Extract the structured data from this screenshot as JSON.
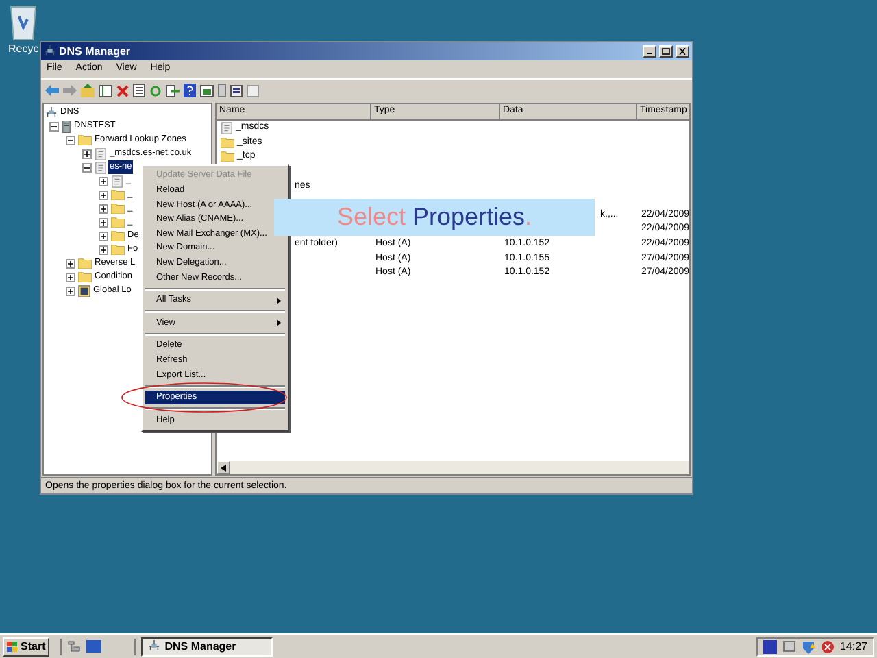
{
  "desktop_icons": [
    {
      "label": "Recyc"
    }
  ],
  "window": {
    "title": "DNS Manager",
    "menu": [
      "File",
      "Action",
      "View",
      "Help"
    ],
    "tree": [
      {
        "label": "DNS",
        "kind": "dns",
        "children": [
          {
            "label": "DNSTEST",
            "kind": "server",
            "expanded": true,
            "children": [
              {
                "label": "Forward Lookup Zones",
                "kind": "folder",
                "expanded": true,
                "children": [
                  {
                    "label": "_msdcs.es-net.co.uk",
                    "kind": "zone",
                    "expanded": false,
                    "selected": false
                  },
                  {
                    "label": "es-ne",
                    "kind": "zone",
                    "expanded": true,
                    "selected": true,
                    "children": [
                      {
                        "label": "_",
                        "kind": "zone",
                        "expanded": false
                      },
                      {
                        "label": "_",
                        "kind": "folder",
                        "expanded": false
                      },
                      {
                        "label": "_",
                        "kind": "folder",
                        "expanded": false
                      },
                      {
                        "label": "_",
                        "kind": "folder",
                        "expanded": false
                      },
                      {
                        "label": "De",
                        "kind": "folder",
                        "expanded": false
                      },
                      {
                        "label": "Fo",
                        "kind": "folder",
                        "expanded": false
                      }
                    ]
                  }
                ]
              },
              {
                "label": "Reverse L",
                "kind": "folder",
                "expanded": false
              },
              {
                "label": "Condition",
                "kind": "folder",
                "expanded": false
              },
              {
                "label": "Global Lo",
                "kind": "log",
                "expanded": false
              }
            ]
          }
        ]
      }
    ],
    "columns": [
      "Name",
      "Type",
      "Data",
      "Timestamp"
    ],
    "rows": [
      {
        "name": "_msdcs",
        "kind": "zone"
      },
      {
        "name": "_sites",
        "kind": "folder"
      },
      {
        "name": "_tcp",
        "kind": "folder"
      },
      {
        "name": "nes",
        "kind": "record",
        "covered": true
      },
      {
        "kind": "record",
        "data": "k.,...",
        "timestamp": "22/04/2009"
      },
      {
        "kind": "record",
        "timestamp": "22/04/2009"
      },
      {
        "name": "ent folder)",
        "kind": "record",
        "covered": true,
        "type": "Host (A)",
        "data": "10.1.0.152",
        "timestamp": "22/04/2009"
      },
      {
        "kind": "record",
        "type": "Host (A)",
        "data": "10.1.0.155",
        "timestamp": "27/04/2009"
      },
      {
        "kind": "record",
        "type": "Host (A)",
        "data": "10.1.0.152",
        "timestamp": "27/04/2009"
      }
    ],
    "status_bar": "Opens the properties dialog box for the current selection."
  },
  "context_menu": [
    {
      "kind": "item",
      "label": "Update Server Data File",
      "disabled": true,
      "selected": false
    },
    {
      "kind": "item",
      "label": "Reload",
      "disabled": false,
      "selected": false
    },
    {
      "kind": "item",
      "label": "New Host (A or AAAA)...",
      "disabled": false,
      "selected": false
    },
    {
      "kind": "item",
      "label": "New Alias (CNAME)...",
      "disabled": false,
      "selected": false
    },
    {
      "kind": "item",
      "label": "New Mail Exchanger (MX)...",
      "disabled": false,
      "selected": false
    },
    {
      "kind": "item",
      "label": "New Domain...",
      "disabled": false,
      "selected": false
    },
    {
      "kind": "item",
      "label": "New Delegation...",
      "disabled": false,
      "selected": false
    },
    {
      "kind": "item",
      "label": "Other New Records...",
      "disabled": false,
      "selected": false
    },
    {
      "kind": "separator"
    },
    {
      "kind": "submenu",
      "label": "All Tasks",
      "disabled": false,
      "selected": false
    },
    {
      "kind": "separator"
    },
    {
      "kind": "submenu",
      "label": "View",
      "disabled": false,
      "selected": false
    },
    {
      "kind": "separator"
    },
    {
      "kind": "item",
      "label": "Delete",
      "disabled": false,
      "selected": false
    },
    {
      "kind": "item",
      "label": "Refresh",
      "disabled": false,
      "selected": false
    },
    {
      "kind": "item",
      "label": "Export List...",
      "disabled": false,
      "selected": false
    },
    {
      "kind": "separator"
    },
    {
      "kind": "item",
      "label": "Properties",
      "disabled": false,
      "selected": true
    },
    {
      "kind": "separator"
    },
    {
      "kind": "item",
      "label": "Help",
      "disabled": false,
      "selected": false
    }
  ],
  "callout": [
    {
      "text": "Select",
      "color": "#f08a8a"
    },
    {
      "text": " Properties",
      "color": "#2b3990"
    },
    {
      "text": ".",
      "color": "#f08a8a"
    }
  ],
  "taskbar": {
    "start": "Start",
    "tasks": [
      {
        "label": "DNS Manager",
        "selected": true
      }
    ],
    "clock": "14:27"
  }
}
